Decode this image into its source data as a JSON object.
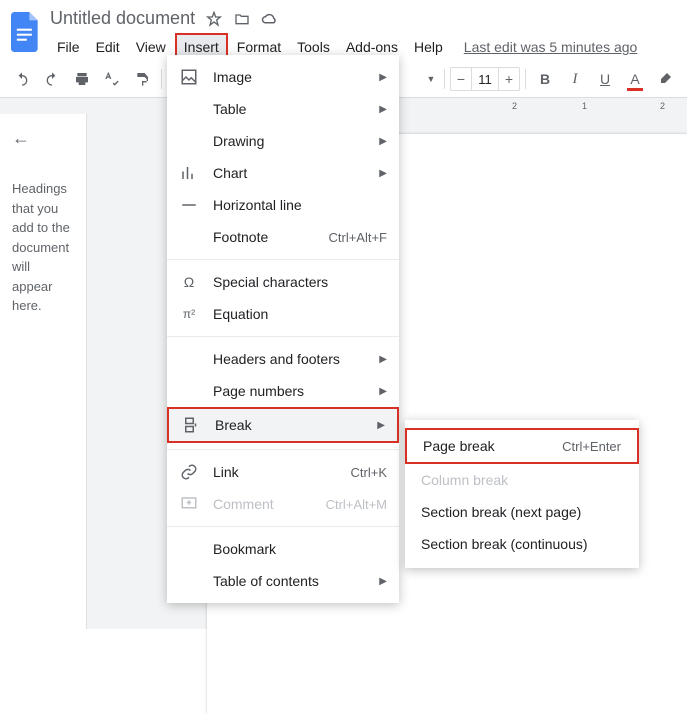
{
  "header": {
    "title": "Untitled document",
    "last_edit": "Last edit was 5 minutes ago"
  },
  "menubar": {
    "file": "File",
    "edit": "Edit",
    "view": "View",
    "insert": "Insert",
    "format": "Format",
    "tools": "Tools",
    "addons": "Add-ons",
    "help": "Help"
  },
  "toolbar": {
    "font_size": "11"
  },
  "outline": {
    "placeholder": "Headings that you add to the document will appear here."
  },
  "insert_menu": {
    "image": "Image",
    "table": "Table",
    "drawing": "Drawing",
    "chart": "Chart",
    "horizontal_line": "Horizontal line",
    "footnote": "Footnote",
    "footnote_shortcut": "Ctrl+Alt+F",
    "special_chars": "Special characters",
    "equation": "Equation",
    "headers_footers": "Headers and footers",
    "page_numbers": "Page numbers",
    "break": "Break",
    "link": "Link",
    "link_shortcut": "Ctrl+K",
    "comment": "Comment",
    "comment_shortcut": "Ctrl+Alt+M",
    "bookmark": "Bookmark",
    "toc": "Table of contents"
  },
  "break_submenu": {
    "page_break": "Page break",
    "page_break_shortcut": "Ctrl+Enter",
    "column_break": "Column break",
    "section_next": "Section break (next page)",
    "section_cont": "Section break (continuous)"
  },
  "ruler": {
    "t2": "2",
    "t1": "1",
    "t2b": "2"
  }
}
